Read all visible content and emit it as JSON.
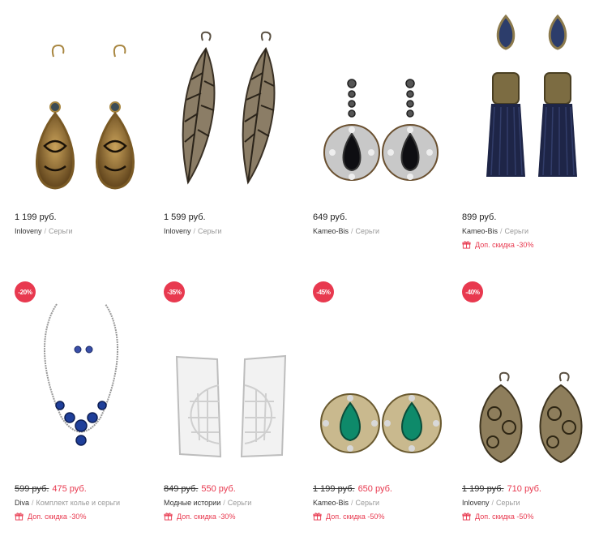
{
  "products": [
    {
      "badge": "",
      "price": "1 199 руб.",
      "old_price": "",
      "new_price": "",
      "brand": "Inloveny",
      "separator": "/",
      "category": "Серьги",
      "promo": ""
    },
    {
      "badge": "",
      "price": "1 599 руб.",
      "old_price": "",
      "new_price": "",
      "brand": "Inloveny",
      "separator": "/",
      "category": "Серьги",
      "promo": ""
    },
    {
      "badge": "",
      "price": "649 руб.",
      "old_price": "",
      "new_price": "",
      "brand": "Kameo-Bis",
      "separator": "/",
      "category": "Серьги",
      "promo": ""
    },
    {
      "badge": "",
      "price": "899 руб.",
      "old_price": "",
      "new_price": "",
      "brand": "Kameo-Bis",
      "separator": "/",
      "category": "Серьги",
      "promo": "Доп. скидка -30%"
    },
    {
      "badge": "-20%",
      "price": "",
      "old_price": "599 руб.",
      "new_price": "475 руб.",
      "brand": "Diva",
      "separator": "/",
      "category": "Комплект колье и серьги",
      "promo": "Доп. скидка -30%"
    },
    {
      "badge": "-35%",
      "price": "",
      "old_price": "849 руб.",
      "new_price": "550 руб.",
      "brand": "Модные истории",
      "separator": "/",
      "category": "Серьги",
      "promo": "Доп. скидка -30%"
    },
    {
      "badge": "-45%",
      "price": "",
      "old_price": "1 199 руб.",
      "new_price": "650 руб.",
      "brand": "Kameo-Bis",
      "separator": "/",
      "category": "Серьги",
      "promo": "Доп. скидка -50%"
    },
    {
      "badge": "-40%",
      "price": "",
      "old_price": "1 199 руб.",
      "new_price": "710 руб.",
      "brand": "Inloveny",
      "separator": "/",
      "category": "Серьги",
      "promo": "Доп. скидка -50%"
    }
  ],
  "colors": {
    "accent": "#e8394f",
    "muted": "#999999",
    "text": "#222222"
  },
  "icons": {
    "promo": "gift-icon"
  }
}
